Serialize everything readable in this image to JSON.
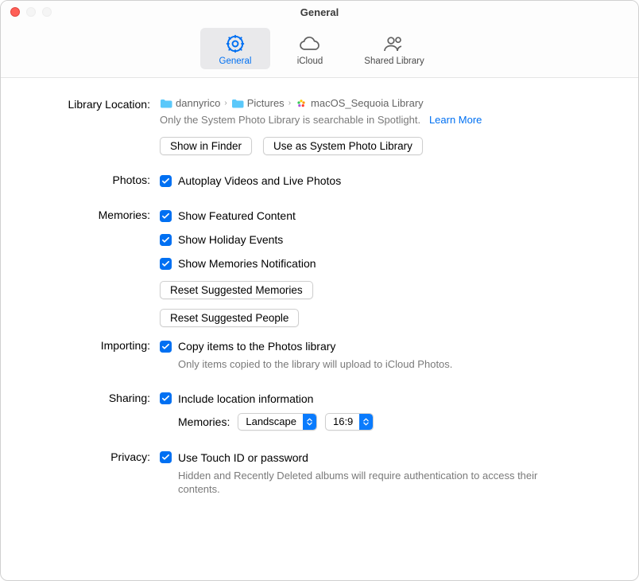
{
  "window": {
    "title": "General"
  },
  "toolbar": {
    "general": "General",
    "icloud": "iCloud",
    "shared": "Shared Library"
  },
  "library": {
    "label": "Library Location:",
    "bc1": "dannyrico",
    "bc2": "Pictures",
    "bc3": "macOS_Sequoia Library",
    "spotlight_note": "Only the System Photo Library is searchable in Spotlight.",
    "learn_more": "Learn More",
    "show_in_finder": "Show in Finder",
    "use_as_system": "Use as System Photo Library"
  },
  "photos": {
    "label": "Photos:",
    "autoplay": "Autoplay Videos and Live Photos"
  },
  "memories": {
    "label": "Memories:",
    "featured": "Show Featured Content",
    "holiday": "Show Holiday Events",
    "notification": "Show Memories Notification",
    "reset_memories": "Reset Suggested Memories",
    "reset_people": "Reset Suggested People"
  },
  "importing": {
    "label": "Importing:",
    "copy": "Copy items to the Photos library",
    "note": "Only items copied to the library will upload to iCloud Photos."
  },
  "sharing": {
    "label": "Sharing:",
    "location": "Include location information",
    "memories_label": "Memories:",
    "orientation": "Landscape",
    "aspect": "16:9"
  },
  "privacy": {
    "label": "Privacy:",
    "touchid": "Use Touch ID or password",
    "note": "Hidden and Recently Deleted albums will require authentication to access their contents."
  }
}
